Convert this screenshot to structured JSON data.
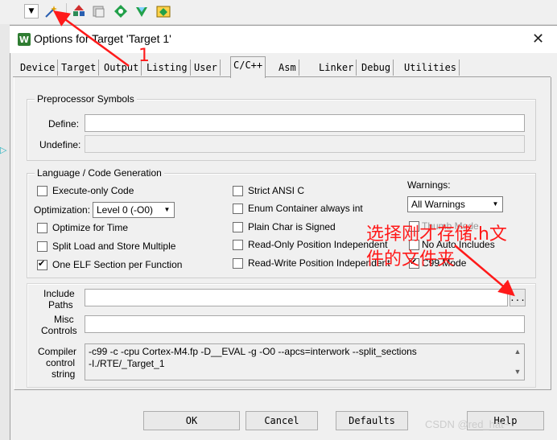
{
  "window": {
    "title": "Options for Target 'Target 1'",
    "close_glyph": "✕"
  },
  "tabs": [
    "Device",
    "Target",
    "Output",
    "Listing",
    "User",
    "C/C++",
    "Asm",
    "Linker",
    "Debug",
    "Utilities"
  ],
  "active_tab": "C/C++",
  "preprocessor": {
    "group_title": "Preprocessor Symbols",
    "define_label": "Define:",
    "undefine_label": "Undefine:",
    "define_value": "",
    "undefine_value": ""
  },
  "language": {
    "group_title": "Language / Code Generation",
    "execute_only": "Execute-only Code",
    "optimization_label": "Optimization:",
    "optimization_value": "Level 0 (-O0)",
    "optimize_time": "Optimize for Time",
    "split_load": "Split Load and Store Multiple",
    "one_elf": "One ELF Section per Function",
    "strict_ansi": "Strict ANSI C",
    "enum_container": "Enum Container always int",
    "plain_char": "Plain Char is Signed",
    "ro_pi": "Read-Only Position Independent",
    "rw_pi": "Read-Write Position Independent",
    "warnings_label": "Warnings:",
    "warnings_value": "All Warnings",
    "thumb_mode": "Thumb Mode",
    "no_auto_includes": "No Auto Includes",
    "c99_mode": "C99 Mode"
  },
  "include_paths": {
    "label_1": "Include",
    "label_2": "Paths",
    "value": "",
    "browse": "..."
  },
  "misc_controls": {
    "label_1": "Misc",
    "label_2": "Controls",
    "value": ""
  },
  "compiler_control": {
    "label_1": "Compiler",
    "label_2": "control",
    "label_3": "string",
    "line_1": "-c99 -c -cpu Cortex-M4.fp -D__EVAL -g -O0 --apcs=interwork --split_sections",
    "line_2": "-I./RTE/_Target_1"
  },
  "buttons": {
    "ok": "OK",
    "cancel": "Cancel",
    "defaults": "Defaults",
    "help": "Help"
  },
  "annotation": {
    "number": "1",
    "text_line_1": "选择刚才存储.h文",
    "text_line_2": "件的文件夹"
  },
  "watermark": "CSDN @red_hat~"
}
